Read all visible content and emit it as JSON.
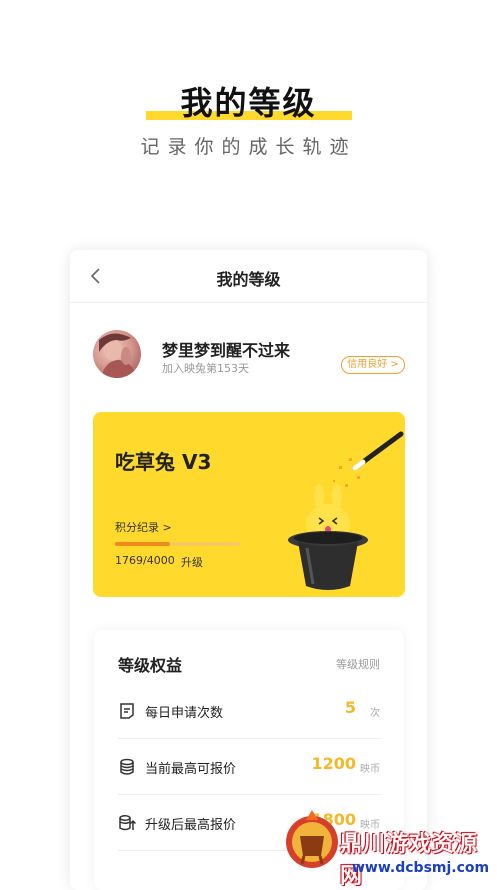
{
  "promo": {
    "title": "我的等级",
    "subtitle": "记录你的成长轨迹"
  },
  "nav": {
    "title": "我的等级",
    "back_icon": "chevron-left-icon"
  },
  "profile": {
    "username": "梦里梦到醒不过来",
    "join_text": "加入映兔第153天",
    "credit_badge": "信用良好 >"
  },
  "level_card": {
    "level_name": "吃草兔 V3",
    "points_link": "积分纪录 >",
    "progress": {
      "current": 1769,
      "total": 4000,
      "fraction": 0.442
    },
    "progress_text": "1769/4000",
    "upgrade_text": "升级",
    "colors": {
      "background": "#ffd92c",
      "progress": "#f08a1c"
    }
  },
  "benefits": {
    "title": "等级权益",
    "rules_link": "等级规则",
    "rows": [
      {
        "icon": "document-icon",
        "label": "每日申请次数",
        "value": "5",
        "unit": "次"
      },
      {
        "icon": "coin-stack-icon",
        "label": "当前最高可报价",
        "value": "1200",
        "unit": "映币"
      },
      {
        "icon": "coin-stack-up-icon",
        "label": "升级后最高报价",
        "value": "1800",
        "unit": "映币"
      }
    ]
  },
  "watermark": {
    "title": "鼎川游戏资源网",
    "url": "www.dcbsmj.com"
  },
  "colors": {
    "accent": "#ffd92c",
    "value": "#f5b829",
    "badge": "#f0a030"
  }
}
